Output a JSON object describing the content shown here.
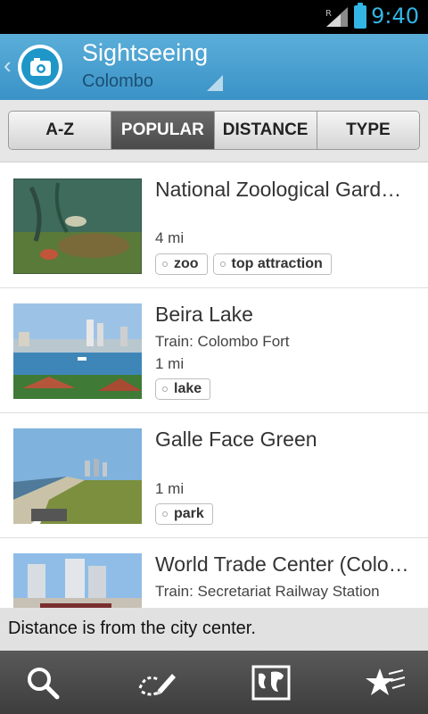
{
  "status_bar": {
    "time": "9:40",
    "roaming": "R"
  },
  "header": {
    "title": "Sightseeing",
    "subtitle": "Colombo",
    "back_glyph": "‹"
  },
  "tabs": [
    {
      "label": "A-Z",
      "active": false
    },
    {
      "label": "POPULAR",
      "active": true
    },
    {
      "label": "DISTANCE",
      "active": false
    },
    {
      "label": "TYPE",
      "active": false
    }
  ],
  "places": [
    {
      "name": "National Zoological Gard…",
      "train": "",
      "distance": "4 mi",
      "tags": [
        "zoo",
        "top attraction"
      ]
    },
    {
      "name": "Beira Lake",
      "train": "Train: Colombo Fort",
      "distance": "1 mi",
      "tags": [
        "lake"
      ]
    },
    {
      "name": "Galle Face Green",
      "train": "",
      "distance": "1 mi",
      "tags": [
        "park"
      ]
    },
    {
      "name": "World Trade Center (Colo…",
      "train": "Train: Secretariat Railway Station",
      "distance": "",
      "tags": []
    }
  ],
  "info_text": "Distance is from the city center.",
  "bottom_nav": [
    {
      "icon": "search-icon"
    },
    {
      "icon": "trip-planner-icon"
    },
    {
      "icon": "map-icon"
    },
    {
      "icon": "favorites-icon"
    }
  ],
  "colors": {
    "accent": "#33b5e5",
    "header": "#4aa2d2",
    "active_tab": "#555555"
  }
}
